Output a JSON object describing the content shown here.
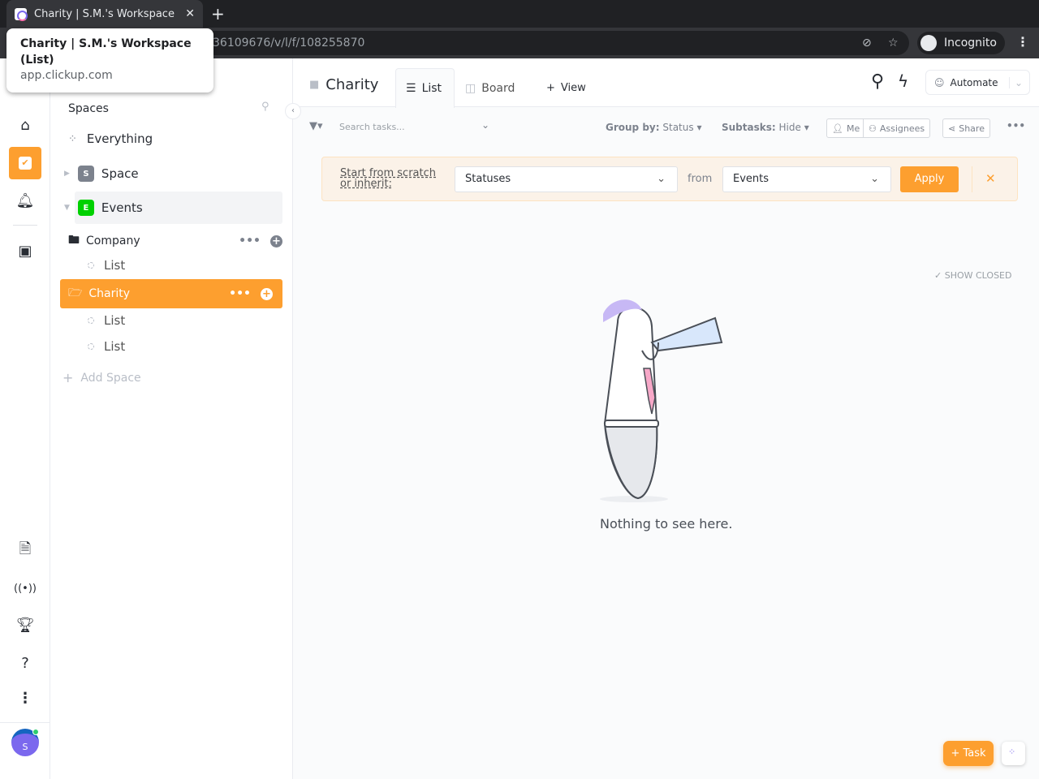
{
  "browser": {
    "tab_title": "Charity | S.M.'s Workspace",
    "url": "36109676/v/l/f/108255870",
    "profile": "Incognito",
    "tooltip": {
      "title": "Charity | S.M.'s Workspace (List)",
      "domain": "app.clickup.com"
    }
  },
  "sidebar": {
    "header": "Spaces",
    "everything": "Everything",
    "space": {
      "label": "Space",
      "badge": "S",
      "color": "#7c828d"
    },
    "events": {
      "label": "Events",
      "badge": "E",
      "color": "#00d100"
    },
    "company": "Company",
    "company_list": "List",
    "charity": "Charity",
    "charity_lists": [
      "List",
      "List"
    ],
    "add_space": "Add Space"
  },
  "header": {
    "title": "Charity",
    "tabs": [
      "List",
      "Board"
    ],
    "add_view": "View",
    "automate": "Automate"
  },
  "toolbar": {
    "search_placeholder": "Search tasks...",
    "group_by_label": "Group by:",
    "group_by_value": "Status",
    "subtasks_label": "Subtasks:",
    "subtasks_value": "Hide",
    "me": "Me",
    "assignees": "Assignees",
    "share": "Share"
  },
  "banner": {
    "prompt": "Start from scratch or inherit:",
    "statuses": "Statuses",
    "from": "from",
    "source": "Events",
    "apply": "Apply"
  },
  "content": {
    "show_closed": "SHOW CLOSED",
    "empty": "Nothing to see here."
  },
  "fab": {
    "task": "Task"
  },
  "user": {
    "initial": "S"
  },
  "colors": {
    "accent": "#fd9f2f"
  }
}
